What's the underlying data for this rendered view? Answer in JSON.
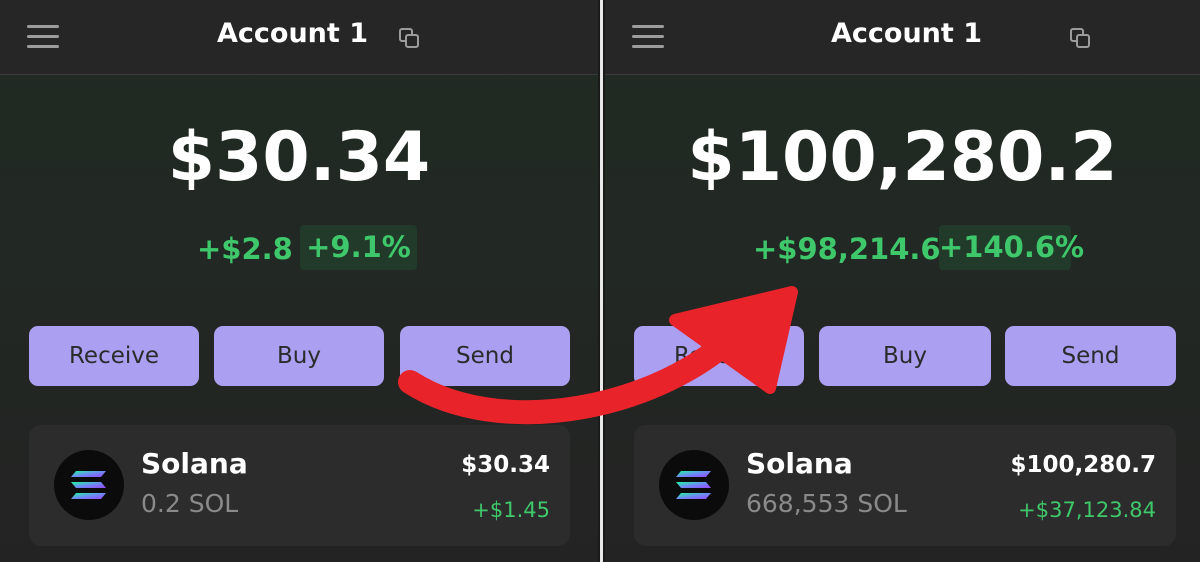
{
  "left": {
    "account_name": "Account 1",
    "balance": "$30.34",
    "change_amount": "+$2.8",
    "change_percent": "+9.1%",
    "buttons": {
      "receive": "Receive",
      "buy": "Buy",
      "send": "Send"
    },
    "token": {
      "name": "Solana",
      "amount": "0.2 SOL",
      "value": "$30.34",
      "change": "+$1.45"
    }
  },
  "right": {
    "account_name": "Account 1",
    "balance": "$100,280.2",
    "change_amount": "+$98,214.6",
    "change_percent": "+140.6%",
    "buttons": {
      "receive": "Receive",
      "buy": "Buy",
      "send": "Send"
    },
    "token": {
      "name": "Solana",
      "amount": "668,553 SOL",
      "value": "$100,280.7",
      "change": "+$37,123.84"
    }
  },
  "colors": {
    "accent_button": "#ab9ff2",
    "positive": "#3fc86b",
    "positive_badge_bg": "#213a29",
    "annotation_arrow": "#e8232a"
  },
  "icons": [
    "hamburger-menu-icon",
    "copy-icon",
    "solana-logo-icon",
    "curved-arrow"
  ]
}
